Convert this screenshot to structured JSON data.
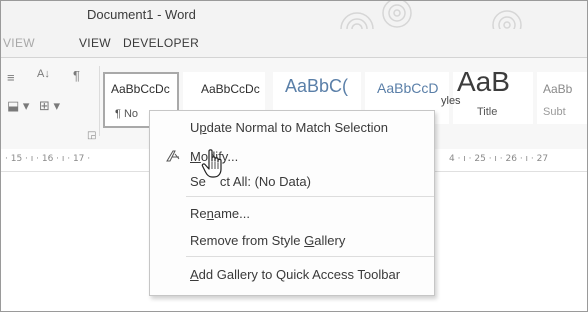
{
  "window": {
    "title": "Document1 - Word"
  },
  "tabs": [
    {
      "label": "VIEW",
      "faded": true
    },
    {
      "label": "VIEW",
      "faded": false
    },
    {
      "label": "DEVELOPER",
      "faded": false
    }
  ],
  "ribbon": {
    "group_label": "yles",
    "styles": [
      {
        "sample": "AaBbCcDc",
        "caption": "¶ No"
      },
      {
        "sample": "AaBbCcDc",
        "caption": ""
      },
      {
        "sample": "AaBbC(",
        "caption": ""
      },
      {
        "sample": "AaBbCcD",
        "caption": ""
      },
      {
        "sample": "AaB",
        "caption": "Title"
      },
      {
        "sample": "AaBb",
        "caption": "Subt"
      }
    ]
  },
  "ruler": {
    "left": "· 15 · ı · 16 · ı · 17 ·",
    "right": "4 · ı · 25 · ı · 26 · ı · 27"
  },
  "context_menu": {
    "items": [
      {
        "pre": "U",
        "mnem": "p",
        "post": "date Normal to Match Selection"
      },
      {
        "pre": "",
        "mnem": "M",
        "post": "odify..."
      },
      {
        "pre": "Se",
        "mnem": "",
        "post": "ct All: (No Data)"
      },
      {
        "pre": "Re",
        "mnem": "n",
        "post": "ame..."
      },
      {
        "pre": "Remove from Style ",
        "mnem": "G",
        "post": "allery"
      },
      {
        "pre": "",
        "mnem": "A",
        "post": "dd Gallery to Quick Access Toolbar"
      }
    ]
  },
  "colors": {
    "menu_bg": "#fdfdfd",
    "ribbon_bg": "#f7f7f7",
    "selected_border": "#a9a9a9"
  },
  "icons": [
    "swirl-decoration-icon",
    "sort-icon",
    "pilcrow-icon",
    "shading-icon",
    "borders-icon",
    "dialog-launcher-icon",
    "modify-style-icon",
    "hand-cursor-icon"
  ]
}
